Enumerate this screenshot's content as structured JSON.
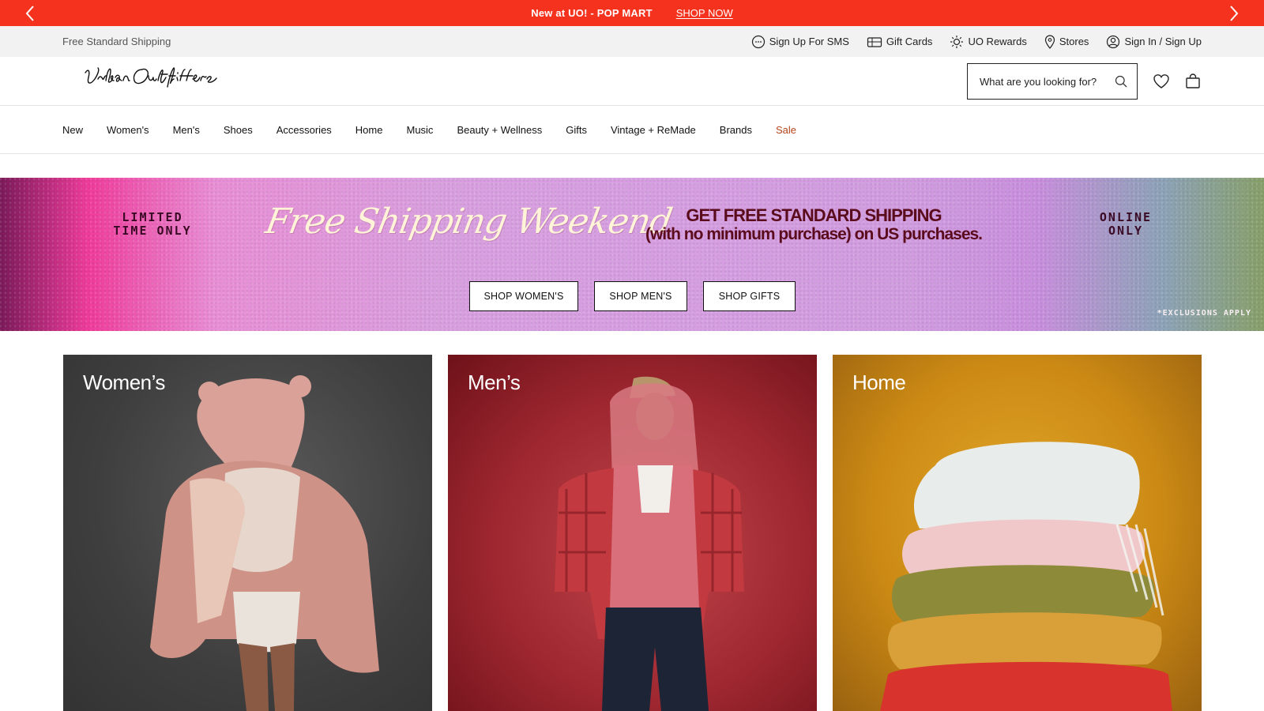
{
  "promo": {
    "text": "New at UO! - POP MART",
    "link": "SHOP NOW",
    "prev_icon": "chevron-left-icon",
    "next_icon": "chevron-right-icon",
    "background_color": "#f5321e"
  },
  "utility": {
    "shipping": "Free Standard Shipping",
    "links": [
      {
        "label": "Sign Up For SMS",
        "icon": "chat-bubble-icon"
      },
      {
        "label": "Gift Cards",
        "icon": "gift-card-icon"
      },
      {
        "label": "UO Rewards",
        "icon": "sun-icon"
      },
      {
        "label": "Stores",
        "icon": "location-pin-icon"
      },
      {
        "label": "Sign In / Sign Up",
        "icon": "user-icon"
      }
    ]
  },
  "header": {
    "logo_text": "Urban Outfitters",
    "search_placeholder": "What are you looking for?",
    "icons": [
      "search-icon",
      "heart-icon",
      "shopping-bag-icon"
    ]
  },
  "nav": {
    "items": [
      "New",
      "Women's",
      "Men's",
      "Shoes",
      "Accessories",
      "Home",
      "Music",
      "Beauty + Wellness",
      "Gifts",
      "Vintage + ReMade",
      "Brands",
      "Sale"
    ],
    "sale_color": "#b5451b"
  },
  "hero": {
    "left_line1": "LIMITED",
    "left_line2": "TIME ONLY",
    "script": "Free Shipping Weekend",
    "headline_line1": "GET FREE STANDARD SHIPPING",
    "headline_line2": "(with no minimum purchase) on US purchases.",
    "right_line1": "ONLINE",
    "right_line2": "ONLY",
    "buttons": [
      "SHOP WOMEN'S",
      "SHOP MEN'S",
      "SHOP GIFTS"
    ],
    "note": "*EXCLUSIONS APPLY"
  },
  "categories": [
    {
      "title": "Women’s"
    },
    {
      "title": "Men’s"
    },
    {
      "title": "Home"
    }
  ]
}
